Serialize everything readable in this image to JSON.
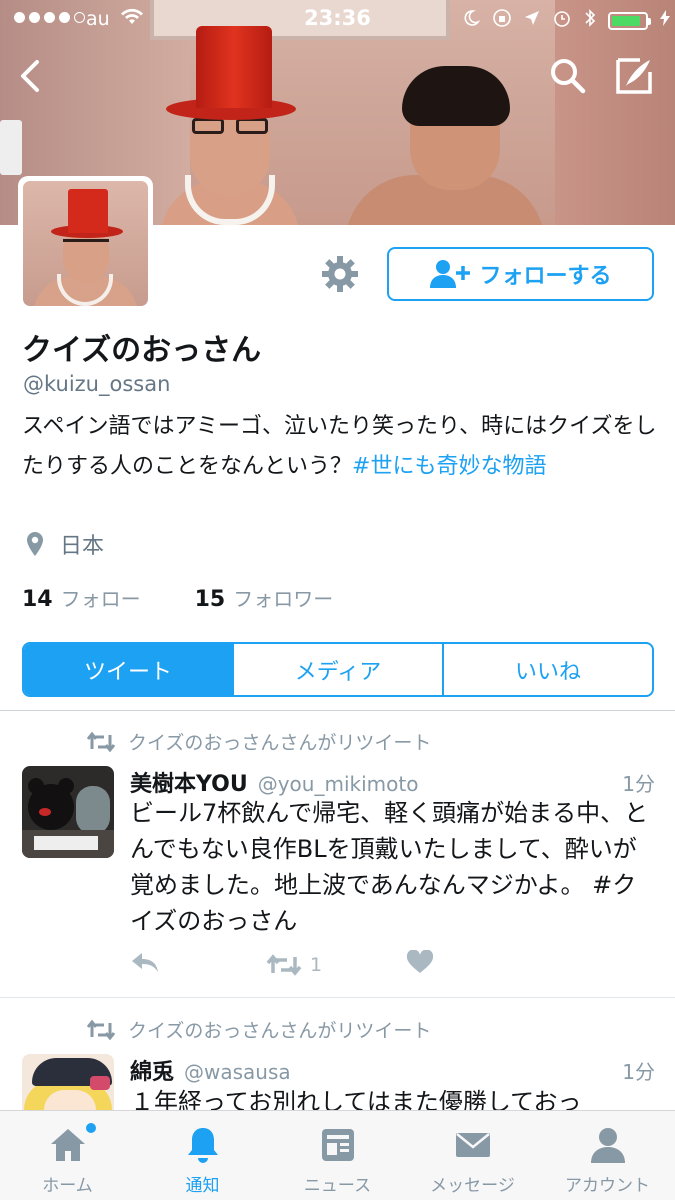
{
  "status_bar": {
    "carrier": "au",
    "time": "23:36"
  },
  "profile": {
    "display_name": "クイズのおっさん",
    "handle": "@kuizu_ossan",
    "bio_text": "スペイン語ではアミーゴ、泣いたり笑ったり、時にはクイズをしたりする人のことをなんという？",
    "bio_hashtag": "#世にも奇妙な物語",
    "location": "日本",
    "following_count": "14",
    "following_label": "フォロー",
    "followers_count": "15",
    "followers_label": "フォロワー",
    "follow_button_label": "フォローする"
  },
  "tabs": [
    {
      "label": "ツイート",
      "active": true
    },
    {
      "label": "メディア",
      "active": false
    },
    {
      "label": "いいね",
      "active": false
    }
  ],
  "tweets": [
    {
      "retweet_label": "クイズのおっさんさんがリツイート",
      "name": "美樹本YOU",
      "username": "@you_mikimoto",
      "time": "1分",
      "text": "ビール7杯飲んで帰宅、軽く頭痛が始まる中、とんでもない良作BLを頂戴いたしまして、酔いが覚めました。地上波であんなんマジかよ。 #クイズのおっさん",
      "retweet_count": "1"
    },
    {
      "retweet_label": "クイズのおっさんさんがリツイート",
      "name": "綿兎",
      "username": "@wasausa",
      "time": "1分",
      "text": "１年経ってお別れしてはまた優勝しておっ"
    }
  ],
  "tab_bar": [
    {
      "label": "ホーム",
      "icon": "home-icon",
      "badge": true
    },
    {
      "label": "通知",
      "icon": "bell-icon",
      "active": true
    },
    {
      "label": "ニュース",
      "icon": "news-icon"
    },
    {
      "label": "メッセージ",
      "icon": "envelope-icon"
    },
    {
      "label": "アカウント",
      "icon": "person-icon"
    }
  ],
  "colors": {
    "accent": "#1da1f2",
    "muted": "#8899a6"
  }
}
